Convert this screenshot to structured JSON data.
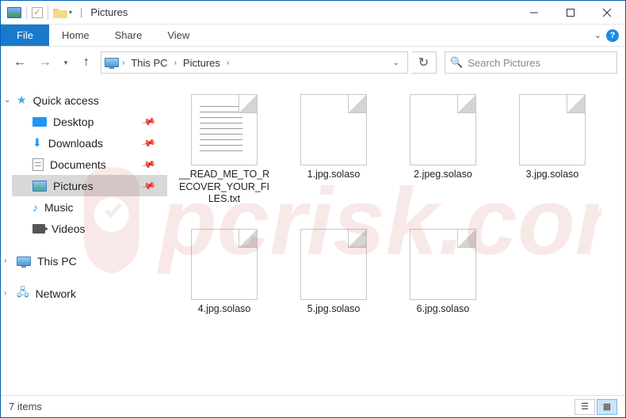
{
  "title": "Pictures",
  "ribbon": {
    "file": "File",
    "home": "Home",
    "share": "Share",
    "view": "View"
  },
  "breadcrumb": {
    "root": "This PC",
    "folder": "Pictures"
  },
  "search": {
    "placeholder": "Search Pictures"
  },
  "nav": {
    "quick_access": "Quick access",
    "desktop": "Desktop",
    "downloads": "Downloads",
    "documents": "Documents",
    "pictures": "Pictures",
    "music": "Music",
    "videos": "Videos",
    "this_pc": "This PC",
    "network": "Network"
  },
  "files": [
    {
      "name": "__READ_ME_TO_RECOVER_YOUR_FILES.txt",
      "type": "txt"
    },
    {
      "name": "1.jpg.solaso",
      "type": "blank"
    },
    {
      "name": "2.jpeg.solaso",
      "type": "blank"
    },
    {
      "name": "3.jpg.solaso",
      "type": "blank"
    },
    {
      "name": "4.jpg.solaso",
      "type": "blank"
    },
    {
      "name": "5.jpg.solaso",
      "type": "blank"
    },
    {
      "name": "6.jpg.solaso",
      "type": "blank"
    }
  ],
  "status": {
    "count": "7 items"
  },
  "watermark": "pcrisk.com"
}
